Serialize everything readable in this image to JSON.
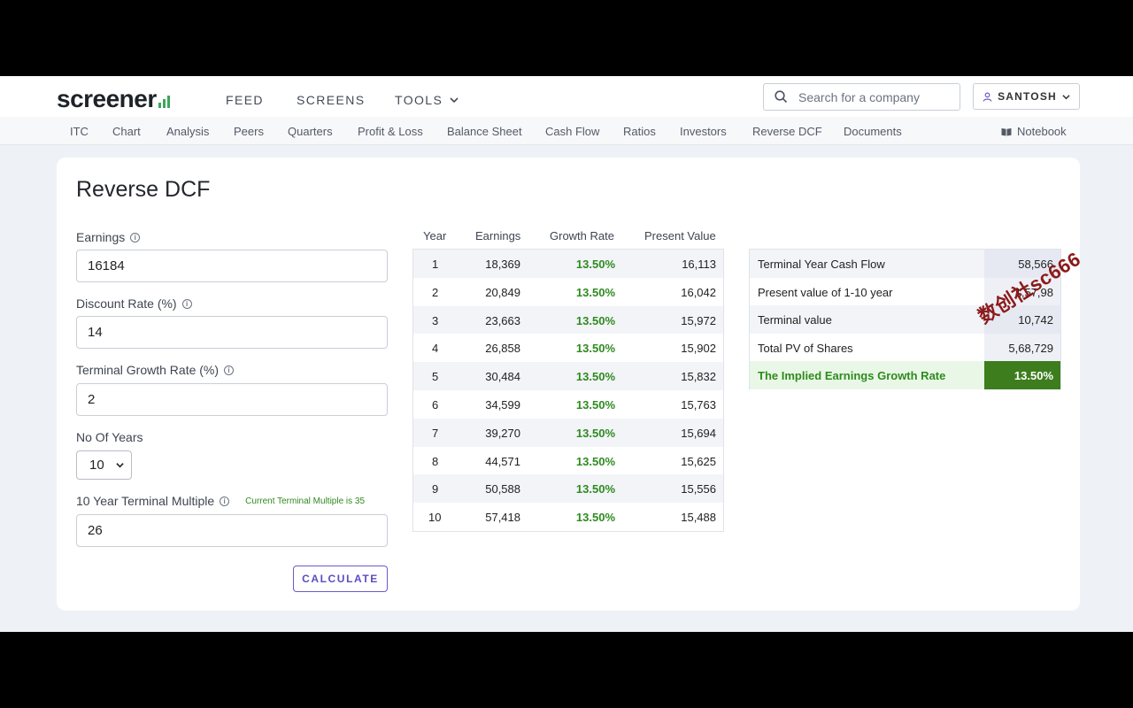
{
  "header": {
    "logo_text": "screener",
    "nav": [
      "FEED",
      "SCREENS",
      "TOOLS"
    ],
    "search_placeholder": "Search for a company",
    "user_name": "SANTOSH"
  },
  "subnav": {
    "items": [
      "ITC",
      "Chart",
      "Analysis",
      "Peers",
      "Quarters",
      "Profit & Loss",
      "Balance Sheet",
      "Cash Flow",
      "Ratios",
      "Investors",
      "Reverse DCF",
      "Documents"
    ],
    "notebook_label": "Notebook"
  },
  "page": {
    "title": "Reverse DCF"
  },
  "form": {
    "earnings_label": "Earnings",
    "earnings_value": "16184",
    "discount_label": "Discount Rate (%)",
    "discount_value": "14",
    "terminal_growth_label": "Terminal Growth Rate (%)",
    "terminal_growth_value": "2",
    "years_label": "No Of Years",
    "years_value": "10",
    "multiple_label": "10 Year Terminal Multiple",
    "multiple_hint": "Current Terminal Multiple is 35",
    "multiple_value": "26",
    "calculate_label": "CALCULATE"
  },
  "projection": {
    "headers": [
      "Year",
      "Earnings",
      "Growth Rate",
      "Present Value"
    ],
    "rows": [
      [
        "1",
        "18,369",
        "13.50%",
        "16,113"
      ],
      [
        "2",
        "20,849",
        "13.50%",
        "16,042"
      ],
      [
        "3",
        "23,663",
        "13.50%",
        "15,972"
      ],
      [
        "4",
        "26,858",
        "13.50%",
        "15,902"
      ],
      [
        "5",
        "30,484",
        "13.50%",
        "15,832"
      ],
      [
        "6",
        "34,599",
        "13.50%",
        "15,763"
      ],
      [
        "7",
        "39,270",
        "13.50%",
        "15,694"
      ],
      [
        "8",
        "44,571",
        "13.50%",
        "15,625"
      ],
      [
        "9",
        "50,588",
        "13.50%",
        "15,556"
      ],
      [
        "10",
        "57,418",
        "13.50%",
        "15,488"
      ]
    ]
  },
  "summary": {
    "rows": [
      [
        "Terminal Year Cash Flow",
        "58,566"
      ],
      [
        "Present value of 1-10 year",
        "1,57,98"
      ],
      [
        "Terminal value",
        "10,742"
      ],
      [
        "Total PV of Shares",
        "5,68,729"
      ]
    ],
    "final_label": "The Implied Earnings Growth Rate",
    "final_value": "13.50%"
  },
  "watermark": "数创社sc666",
  "colors": {
    "accent_green": "#3d7d1e",
    "button_purple": "#5b4cc4"
  }
}
